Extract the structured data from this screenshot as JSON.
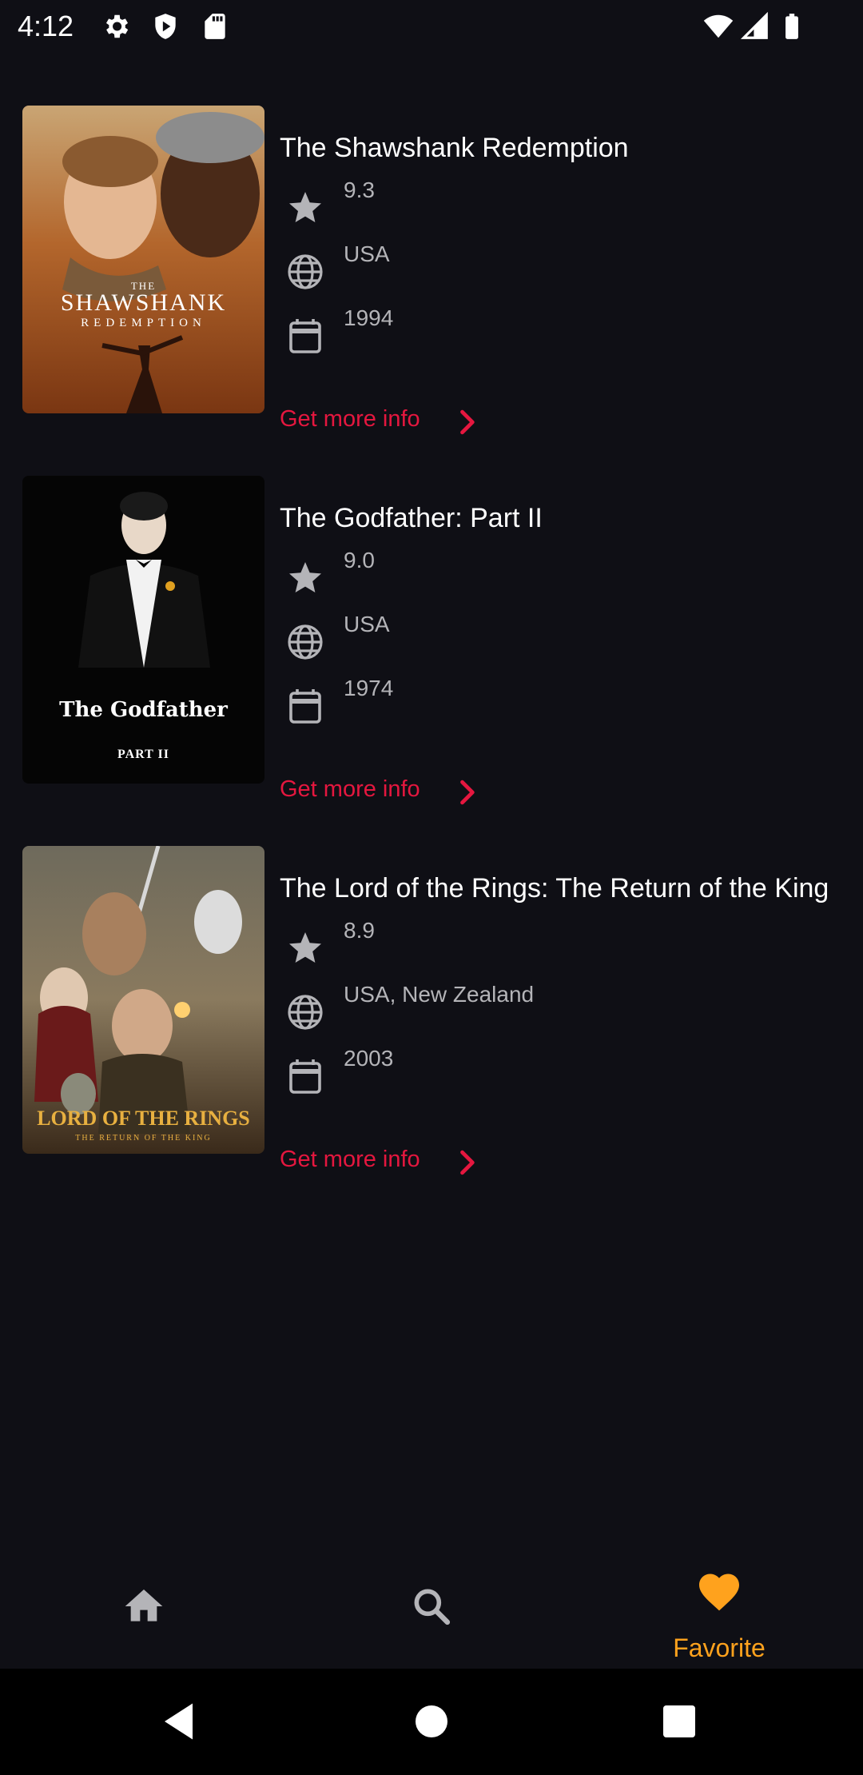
{
  "status_bar": {
    "time": "4:12",
    "left_icons": [
      "gear-icon",
      "shield-icon",
      "sd-card-icon"
    ],
    "right_icons": [
      "wifi-icon",
      "signal-icon",
      "battery-icon"
    ]
  },
  "movies": [
    {
      "title": "The Shawshank Redemption",
      "rating": "9.3",
      "country": "USA",
      "year": "1994",
      "more_label": "Get more info",
      "poster_caption": "SHAWSHANK",
      "poster_subcaption": "REDEMPTION"
    },
    {
      "title": "The Godfather: Part II",
      "rating": "9.0",
      "country": "USA",
      "year": "1974",
      "more_label": "Get more info",
      "poster_caption": "The Godfather",
      "poster_subcaption": "PART II"
    },
    {
      "title": "The Lord of the Rings: The Return of the King",
      "rating": "8.9",
      "country": "USA, New Zealand",
      "year": "2003",
      "more_label": "Get more info",
      "poster_caption": "LORD OF THE RINGS",
      "poster_subcaption": "THE RETURN OF THE KING"
    }
  ],
  "bottom_nav": {
    "items": [
      {
        "icon": "home-icon",
        "label": ""
      },
      {
        "icon": "search-icon",
        "label": ""
      },
      {
        "icon": "heart-icon",
        "label": "Favorite",
        "selected": true
      }
    ],
    "active_color": "#ffa21d"
  },
  "colors": {
    "background": "#0f0f15",
    "accent_link": "#e5173f",
    "secondary_text": "#b4b4b8"
  }
}
